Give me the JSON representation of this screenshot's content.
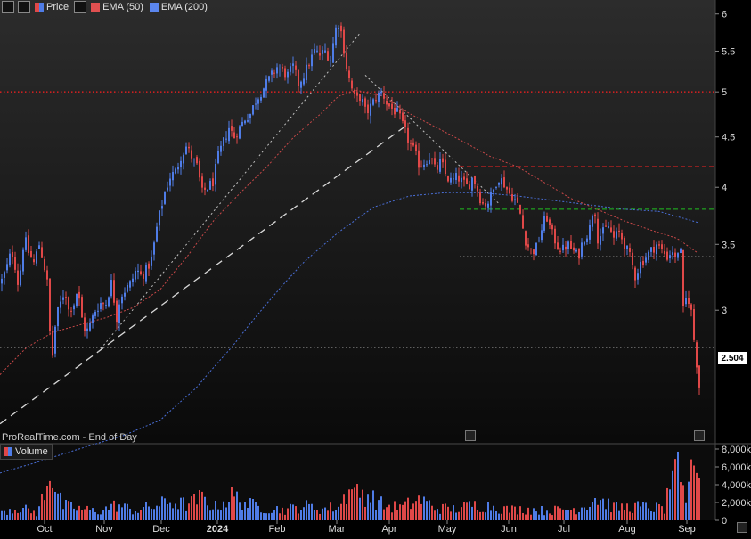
{
  "legend": {
    "price_label": "Price",
    "ema50_label": "EMA (50)",
    "ema200_label": "EMA (200)",
    "volume_label": "Volume"
  },
  "watermark": "ProRealTime.com - End of Day",
  "last_price_badge": "2.504",
  "colors": {
    "background": "#000000",
    "up": "#4f7ce6",
    "down": "#e04848",
    "ema50": "#c84848",
    "ema200": "#4a6fd8",
    "hline_red": "#cc2020",
    "hline_green": "#20c020",
    "hline_white": "#b0b0b0",
    "axis_text": "#dcdcdc"
  },
  "chart_data": [
    {
      "type": "candlestick",
      "title": "",
      "x_tick_labels": [
        "Oct",
        "Nov",
        "Dec",
        "2024",
        "Feb",
        "Mar",
        "Apr",
        "May",
        "Jun",
        "Jul",
        "Aug",
        "Sep"
      ],
      "y_tick_labels": [
        "6",
        "5.5",
        "5",
        "4.5",
        "4",
        "3.5",
        "3"
      ],
      "y_ticks": [
        6,
        5.5,
        5,
        4.5,
        4,
        3.5,
        3
      ],
      "ylim": [
        2.2,
        6.2
      ],
      "scale": "log",
      "last_price": 2.504,
      "close_path": [
        [
          0,
          3.2
        ],
        [
          6,
          3.3
        ],
        [
          12,
          3.45
        ],
        [
          17,
          3.3
        ],
        [
          20,
          3.15
        ],
        [
          24,
          3.45
        ],
        [
          27,
          3.55
        ],
        [
          30,
          3.45
        ],
        [
          37,
          3.35
        ],
        [
          43,
          3.5
        ],
        [
          48,
          3.35
        ],
        [
          52,
          3.2
        ],
        [
          55,
          2.85
        ],
        [
          58,
          2.7
        ],
        [
          62,
          2.95
        ],
        [
          67,
          3.05
        ],
        [
          72,
          3.15
        ],
        [
          76,
          3.0
        ],
        [
          82,
          3.05
        ],
        [
          86,
          3.15
        ],
        [
          92,
          2.9
        ],
        [
          96,
          2.85
        ],
        [
          100,
          2.9
        ],
        [
          106,
          3.0
        ],
        [
          112,
          3.05
        ],
        [
          118,
          3.05
        ],
        [
          124,
          3.2
        ],
        [
          130,
          2.95
        ],
        [
          134,
          3.1
        ],
        [
          140,
          3.15
        ],
        [
          146,
          3.2
        ],
        [
          152,
          3.3
        ],
        [
          158,
          3.25
        ],
        [
          164,
          3.3
        ],
        [
          170,
          3.4
        ],
        [
          174,
          3.6
        ],
        [
          178,
          3.75
        ],
        [
          184,
          3.95
        ],
        [
          190,
          4.1
        ],
        [
          196,
          4.15
        ],
        [
          202,
          4.3
        ],
        [
          208,
          4.4
        ],
        [
          214,
          4.3
        ],
        [
          220,
          4.2
        ],
        [
          226,
          3.95
        ],
        [
          232,
          4.0
        ],
        [
          238,
          4.05
        ],
        [
          244,
          4.3
        ],
        [
          250,
          4.45
        ],
        [
          256,
          4.6
        ],
        [
          262,
          4.5
        ],
        [
          268,
          4.6
        ],
        [
          274,
          4.7
        ],
        [
          280,
          4.75
        ],
        [
          286,
          4.9
        ],
        [
          292,
          5.0
        ],
        [
          298,
          5.1
        ],
        [
          304,
          5.2
        ],
        [
          310,
          5.3
        ],
        [
          316,
          5.25
        ],
        [
          322,
          5.2
        ],
        [
          328,
          5.3
        ],
        [
          334,
          5.1
        ],
        [
          340,
          5.2
        ],
        [
          346,
          5.35
        ],
        [
          352,
          5.5
        ],
        [
          358,
          5.45
        ],
        [
          364,
          5.5
        ],
        [
          370,
          5.4
        ],
        [
          376,
          5.8
        ],
        [
          380,
          5.9
        ],
        [
          384,
          5.6
        ],
        [
          388,
          5.3
        ],
        [
          392,
          5.1
        ],
        [
          398,
          4.9
        ],
        [
          404,
          4.95
        ],
        [
          410,
          4.75
        ],
        [
          416,
          4.85
        ],
        [
          422,
          4.95
        ],
        [
          428,
          5.0
        ],
        [
          434,
          4.85
        ],
        [
          440,
          4.8
        ],
        [
          446,
          4.75
        ],
        [
          452,
          4.6
        ],
        [
          458,
          4.45
        ],
        [
          464,
          4.35
        ],
        [
          470,
          4.2
        ],
        [
          476,
          4.25
        ],
        [
          482,
          4.3
        ],
        [
          488,
          4.15
        ],
        [
          494,
          4.25
        ],
        [
          500,
          4.1
        ],
        [
          506,
          4.05
        ],
        [
          512,
          4.1
        ],
        [
          518,
          4.05
        ],
        [
          524,
          4.0
        ],
        [
          530,
          4.1
        ],
        [
          536,
          3.95
        ],
        [
          540,
          3.85
        ],
        [
          546,
          3.85
        ],
        [
          552,
          3.95
        ],
        [
          558,
          4.1
        ],
        [
          564,
          4.05
        ],
        [
          570,
          3.95
        ],
        [
          576,
          3.9
        ],
        [
          582,
          3.8
        ],
        [
          588,
          3.55
        ],
        [
          594,
          3.45
        ],
        [
          600,
          3.45
        ],
        [
          606,
          3.6
        ],
        [
          612,
          3.75
        ],
        [
          618,
          3.6
        ],
        [
          624,
          3.5
        ],
        [
          630,
          3.45
        ],
        [
          636,
          3.5
        ],
        [
          642,
          3.45
        ],
        [
          648,
          3.4
        ],
        [
          654,
          3.55
        ],
        [
          660,
          3.6
        ],
        [
          666,
          3.85
        ],
        [
          670,
          3.55
        ],
        [
          676,
          3.6
        ],
        [
          682,
          3.65
        ],
        [
          688,
          3.55
        ],
        [
          694,
          3.6
        ],
        [
          700,
          3.5
        ],
        [
          706,
          3.4
        ],
        [
          712,
          3.25
        ],
        [
          718,
          3.35
        ],
        [
          724,
          3.4
        ],
        [
          730,
          3.45
        ],
        [
          736,
          3.5
        ],
        [
          742,
          3.45
        ],
        [
          748,
          3.4
        ],
        [
          754,
          3.45
        ],
        [
          758,
          3.35
        ],
        [
          762,
          3.55
        ],
        [
          764,
          3.3
        ],
        [
          766,
          3.0
        ],
        [
          770,
          3.1
        ],
        [
          774,
          3.05
        ],
        [
          778,
          2.8
        ],
        [
          782,
          2.6
        ],
        [
          785,
          2.504
        ]
      ],
      "ema50_path": [
        [
          0,
          2.58
        ],
        [
          30,
          2.75
        ],
        [
          60,
          2.85
        ],
        [
          90,
          2.9
        ],
        [
          120,
          2.95
        ],
        [
          150,
          3.02
        ],
        [
          180,
          3.15
        ],
        [
          210,
          3.4
        ],
        [
          240,
          3.7
        ],
        [
          270,
          3.95
        ],
        [
          300,
          4.2
        ],
        [
          330,
          4.5
        ],
        [
          360,
          4.75
        ],
        [
          380,
          4.95
        ],
        [
          400,
          5.02
        ],
        [
          430,
          4.95
        ],
        [
          460,
          4.75
        ],
        [
          490,
          4.6
        ],
        [
          520,
          4.45
        ],
        [
          550,
          4.3
        ],
        [
          580,
          4.2
        ],
        [
          610,
          4.05
        ],
        [
          640,
          3.9
        ],
        [
          670,
          3.8
        ],
        [
          700,
          3.7
        ],
        [
          730,
          3.62
        ],
        [
          760,
          3.55
        ],
        [
          785,
          3.42
        ]
      ],
      "ema200_path": [
        [
          0,
          2.05
        ],
        [
          40,
          2.1
        ],
        [
          90,
          2.17
        ],
        [
          140,
          2.24
        ],
        [
          180,
          2.32
        ],
        [
          220,
          2.5
        ],
        [
          260,
          2.75
        ],
        [
          300,
          3.05
        ],
        [
          340,
          3.35
        ],
        [
          380,
          3.6
        ],
        [
          420,
          3.82
        ],
        [
          460,
          3.92
        ],
        [
          500,
          3.95
        ],
        [
          540,
          3.95
        ],
        [
          580,
          3.92
        ],
        [
          620,
          3.88
        ],
        [
          660,
          3.84
        ],
        [
          700,
          3.8
        ],
        [
          740,
          3.78
        ],
        [
          785,
          3.68
        ]
      ],
      "trendlines": [
        {
          "style": "dashed",
          "color": "white",
          "from": [
            0,
            2.3
          ],
          "to": [
            460,
            4.65
          ]
        },
        {
          "style": "dotted",
          "color": "white",
          "from": [
            110,
            2.72
          ],
          "to": [
            405,
            5.75
          ]
        },
        {
          "style": "dotted",
          "color": "white",
          "from": [
            410,
            5.2
          ],
          "to": [
            560,
            3.85
          ]
        }
      ],
      "horizontal_lines": [
        {
          "value": 5.0,
          "color": "red",
          "style": "dotted",
          "x_from": 0
        },
        {
          "value": 4.2,
          "color": "red",
          "style": "dashed",
          "x_from": 516
        },
        {
          "value": 3.8,
          "color": "green",
          "style": "dashed",
          "x_from": 516
        },
        {
          "value": 3.4,
          "color": "white",
          "style": "dotted",
          "x_from": 516
        },
        {
          "value": 2.75,
          "color": "white",
          "style": "dotted",
          "x_from": 0
        }
      ]
    },
    {
      "type": "bar",
      "title": "",
      "series_name": "Volume",
      "y_tick_labels": [
        "8,000k",
        "6,000k",
        "4,000k",
        "2,000k",
        "0"
      ],
      "y_ticks": [
        8000,
        6000,
        4000,
        2000,
        0
      ],
      "ylim": [
        0,
        8500
      ],
      "volume_profile_k": [
        [
          0,
          1200
        ],
        [
          20,
          1600
        ],
        [
          40,
          900
        ],
        [
          55,
          4800
        ],
        [
          70,
          1800
        ],
        [
          90,
          1400
        ],
        [
          110,
          1100
        ],
        [
          130,
          1900
        ],
        [
          150,
          1200
        ],
        [
          170,
          1700
        ],
        [
          190,
          2300
        ],
        [
          210,
          1900
        ],
        [
          225,
          2800
        ],
        [
          240,
          1600
        ],
        [
          260,
          3000
        ],
        [
          280,
          1900
        ],
        [
          300,
          1500
        ],
        [
          320,
          1300
        ],
        [
          340,
          1800
        ],
        [
          360,
          1400
        ],
        [
          380,
          1700
        ],
        [
          390,
          3700
        ],
        [
          410,
          3300
        ],
        [
          430,
          1800
        ],
        [
          450,
          1600
        ],
        [
          470,
          2600
        ],
        [
          490,
          1500
        ],
        [
          510,
          1400
        ],
        [
          530,
          1900
        ],
        [
          550,
          1800
        ],
        [
          570,
          1300
        ],
        [
          590,
          1400
        ],
        [
          610,
          1200
        ],
        [
          630,
          1300
        ],
        [
          650,
          1500
        ],
        [
          668,
          2900
        ],
        [
          690,
          1500
        ],
        [
          710,
          1700
        ],
        [
          730,
          1600
        ],
        [
          745,
          1400
        ],
        [
          760,
          7900
        ],
        [
          765,
          2900
        ],
        [
          770,
          3600
        ],
        [
          775,
          7500
        ],
        [
          780,
          5600
        ],
        [
          785,
          4900
        ]
      ]
    }
  ]
}
